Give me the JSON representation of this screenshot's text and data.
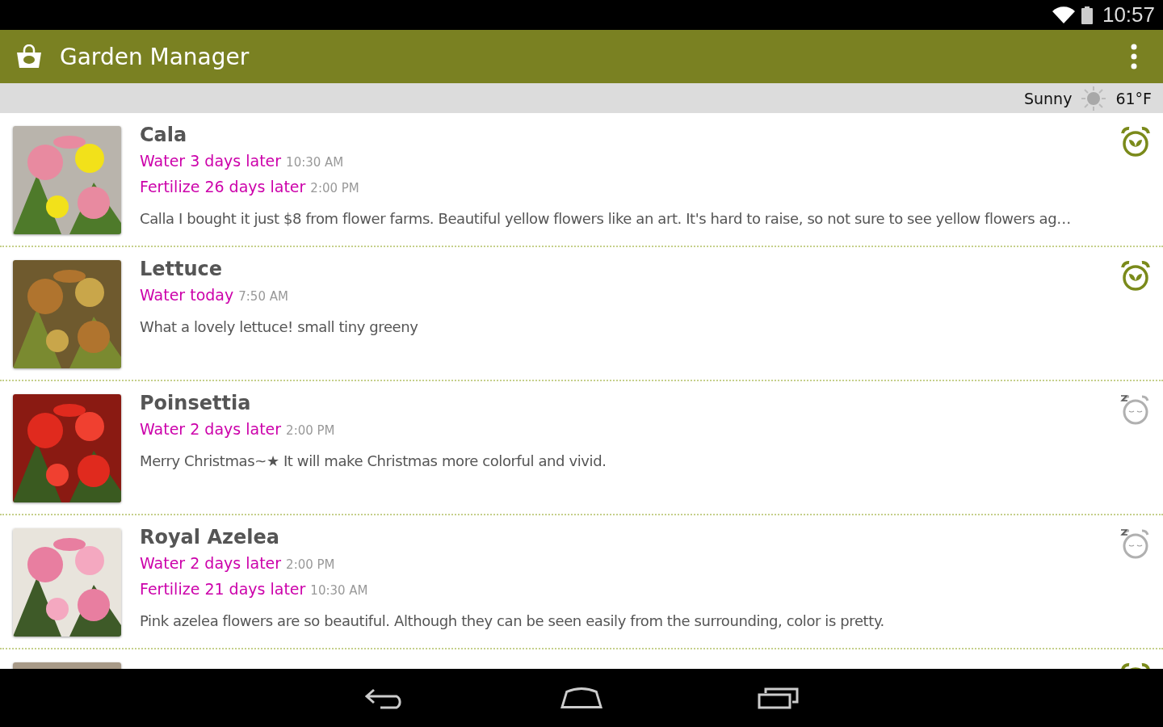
{
  "status_bar": {
    "time": "10:57"
  },
  "app_bar": {
    "title": "Garden Manager"
  },
  "weather": {
    "condition": "Sunny",
    "temperature": "61°F"
  },
  "plants": [
    {
      "name": "Cala",
      "schedules": [
        {
          "task": "Water 3 days later",
          "time": "10:30 AM"
        },
        {
          "task": "Fertilize 26 days later",
          "time": "2:00 PM"
        }
      ],
      "note": "Calla I bought it just $8 from flower farms. Beautiful yellow flowers like an art. It's hard to raise, so not sure to see yellow flowers ag…",
      "alarm_on": true
    },
    {
      "name": "Lettuce",
      "schedules": [
        {
          "task": "Water today",
          "time": "7:50 AM"
        }
      ],
      "note": "What a lovely lettuce! small tiny greeny",
      "alarm_on": true
    },
    {
      "name": "Poinsettia",
      "schedules": [
        {
          "task": "Water 2 days later",
          "time": "2:00 PM"
        }
      ],
      "note": "Merry Christmas~★ It will make Christmas more colorful and vivid.",
      "alarm_on": false
    },
    {
      "name": "Royal Azelea",
      "schedules": [
        {
          "task": "Water 2 days later",
          "time": "2:00 PM"
        },
        {
          "task": "Fertilize 21 days later",
          "time": "10:30 AM"
        }
      ],
      "note": "Pink azelea flowers are so beautiful. Although they can be seen easily from the surrounding, color is pretty.",
      "alarm_on": false
    },
    {
      "alarm_on": true
    }
  ]
}
